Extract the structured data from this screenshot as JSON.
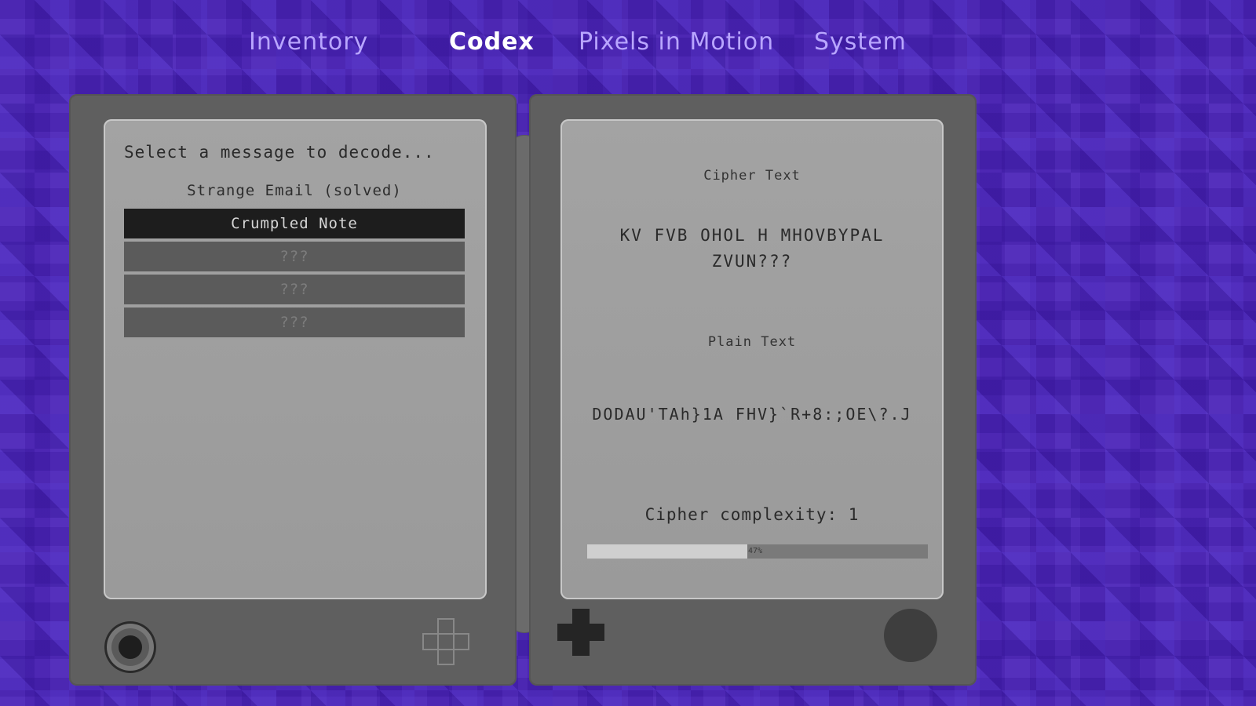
{
  "nav": {
    "tabs": [
      {
        "label": "Inventory"
      },
      {
        "label": "Codex"
      },
      {
        "label": "Pixels in Motion"
      },
      {
        "label": "System"
      }
    ],
    "active": "Codex"
  },
  "left_screen": {
    "prompt": "Select a message to decode...",
    "messages": [
      {
        "label": "Strange Email (solved)",
        "state": "solved"
      },
      {
        "label": "Crumpled Note",
        "state": "selected"
      },
      {
        "label": "???",
        "state": "locked"
      },
      {
        "label": "???",
        "state": "locked"
      },
      {
        "label": "???",
        "state": "locked"
      }
    ]
  },
  "right_screen": {
    "cipher_label": "Cipher Text",
    "cipher_text": "KV FVB OHOL H MHOVBYPAL ZVUN???",
    "plain_label": "Plain Text",
    "plain_text": "DODAU'TAh}1A FHV}`R+8:;OE\\?.J",
    "complexity_label": "Cipher complexity: 1",
    "progress_percent": 47,
    "progress_text": "47%"
  },
  "controls": {
    "left_stick": "joystick-icon",
    "left_dpad": "dpad-outline-icon",
    "right_dpad": "dpad-solid-icon",
    "right_button": "action-button-icon"
  },
  "colors": {
    "background": "#4a22b8",
    "nav_inactive": "#b9a6ff",
    "nav_active": "#ffffff",
    "device": "#5f5f5f",
    "screen": "#a3a3a3"
  }
}
